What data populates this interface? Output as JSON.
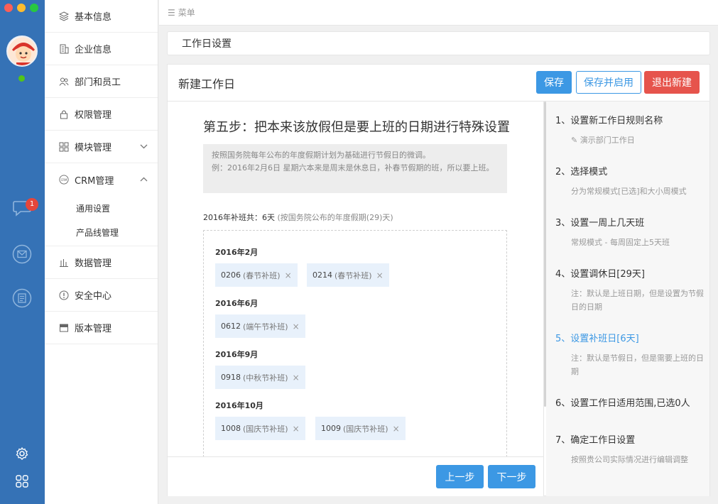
{
  "colors": {
    "rail": "#3572b6",
    "accent": "#3c98e4",
    "danger": "#e6544c",
    "badge": "#e6463b",
    "online": "#52c41a",
    "tag_bg": "#e8f1fb"
  },
  "rail": {
    "badge_count": "1",
    "icons": [
      "chat-icon",
      "mail-icon",
      "document-icon",
      "settings-icon",
      "apps-grid-icon"
    ]
  },
  "menu": {
    "items": [
      {
        "label": "基本信息",
        "icon": "layers-icon"
      },
      {
        "label": "企业信息",
        "icon": "building-icon"
      },
      {
        "label": "部门和员工",
        "icon": "users-icon"
      },
      {
        "label": "权限管理",
        "icon": "lock-icon"
      },
      {
        "label": "模块管理",
        "icon": "modules-icon"
      },
      {
        "label": "CRM管理",
        "icon": "crm-icon"
      },
      {
        "label": "数据管理",
        "icon": "bar-chart-icon"
      },
      {
        "label": "安全中心",
        "icon": "alert-icon"
      },
      {
        "label": "版本管理",
        "icon": "version-icon"
      }
    ],
    "crm_sub": [
      "通用设置",
      "产品线管理"
    ]
  },
  "topbar": {
    "label": "菜单"
  },
  "breadcrumb": {
    "title": "工作日设置"
  },
  "panel": {
    "title": "新建工作日",
    "save_label": "保存",
    "save_enable_label": "保存并启用",
    "exit_label": "退出新建",
    "step_title": "第五步：把本来该放假但是要上班的日期进行特殊设置",
    "notice_line1": "按照国务院每年公布的年度假期计划为基础进行节假日的微调。",
    "notice_line2": "例：2016年2月6日 星期六本来是周末是休息日，补春节假期的班，所以要上班。",
    "summary_main": "2016年补班共：6天",
    "summary_note": "(按国务院公布的年度假期(29)天)",
    "months": [
      {
        "label": "2016年2月",
        "tags": [
          {
            "date": "0206",
            "note": "(春节补班)"
          },
          {
            "date": "0214",
            "note": "(春节补班)"
          }
        ]
      },
      {
        "label": "2016年6月",
        "tags": [
          {
            "date": "0612",
            "note": "(端午节补班)"
          }
        ]
      },
      {
        "label": "2016年9月",
        "tags": [
          {
            "date": "0918",
            "note": "(中秋节补班)"
          }
        ]
      },
      {
        "label": "2016年10月",
        "tags": [
          {
            "date": "1008",
            "note": "(国庆节补班)"
          },
          {
            "date": "1009",
            "note": "(国庆节补班)"
          }
        ]
      }
    ],
    "remove_symbol": "×",
    "prev_label": "上一步",
    "next_label": "下一步"
  },
  "steps": [
    {
      "title": "1、设置新工作日规则名称",
      "sub": "演示部门工作日",
      "sub_icon": "pencil-icon"
    },
    {
      "title": "2、选择模式",
      "sub": "分为常规模式[已选]和大小周模式"
    },
    {
      "title": "3、设置一周上几天班",
      "sub": "常规模式 - 每周固定上5天班"
    },
    {
      "title": "4、设置调休日[29天]",
      "sub": "注：默认是上班日期，但是设置为节假日的日期"
    },
    {
      "title": "5、设置补班日[6天]",
      "sub": "注：默认是节假日，但是需要上班的日期",
      "active": true
    },
    {
      "title": "6、设置工作日适用范围,已选0人",
      "sub": ""
    },
    {
      "title": "7、确定工作日设置",
      "sub": "按照贵公司实际情况进行编辑调整"
    }
  ]
}
